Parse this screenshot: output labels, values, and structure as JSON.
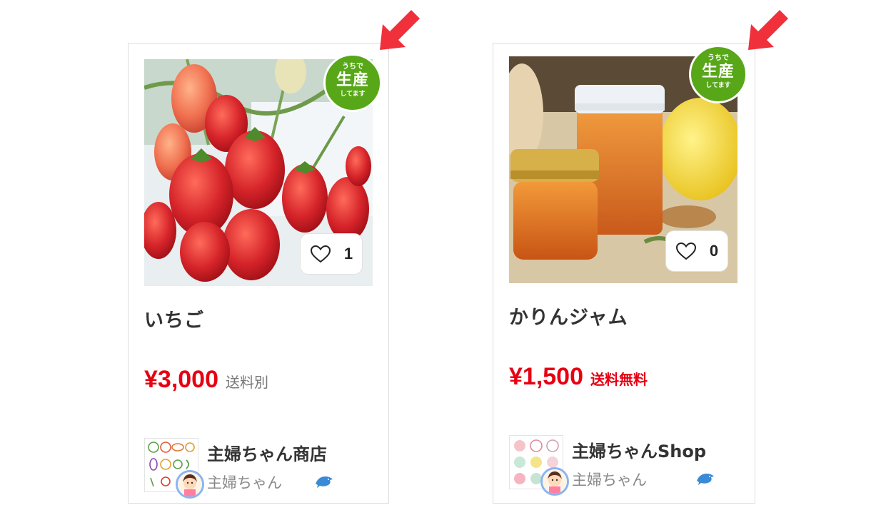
{
  "products": [
    {
      "title": "いちご",
      "price": "¥3,000",
      "shipping": "送料別",
      "likes": "1",
      "badge": {
        "top": "うちで",
        "main": "生産",
        "bottom": "してます"
      },
      "shop_name": "主婦ちゃん商店",
      "seller_name": "主婦ちゃん"
    },
    {
      "title": "かりんジャム",
      "price": "¥1,500",
      "shipping": "送料無料",
      "likes": "0",
      "badge": {
        "top": "うちで",
        "main": "生産",
        "bottom": "してます"
      },
      "shop_name": "主婦ちゃんShop",
      "seller_name": "主婦ちゃん"
    }
  ],
  "colors": {
    "price": "#e60012",
    "badge": "#58a718",
    "arrow": "#f0303a",
    "avatar_ring": "#8ab4f0"
  },
  "icons": [
    "heart-outline-icon",
    "dolphin-icon",
    "red-arrow-icon"
  ]
}
